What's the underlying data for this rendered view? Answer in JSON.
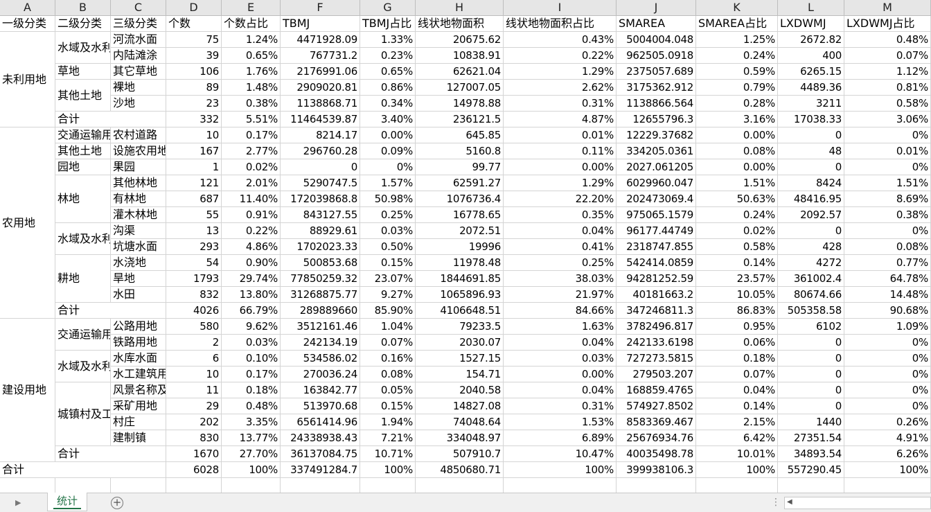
{
  "columns": [
    "A",
    "B",
    "C",
    "D",
    "E",
    "F",
    "G",
    "H",
    "I",
    "J",
    "K",
    "L",
    "M"
  ],
  "header_row": [
    "一级分类",
    "二级分类",
    "三级分类",
    "个数",
    "个数占比",
    "TBMJ",
    "TBMJ占比",
    "线状地物面积",
    "线状地物面积占比",
    "SMAREA",
    "SMAREA占比",
    "LXDWMJ",
    "LXDWMJ占比"
  ],
  "rows": [
    [
      "河流水面",
      "75",
      "1.24%",
      "4471928.09",
      "1.33%",
      "20675.62",
      "0.43%",
      "5004004.048",
      "1.25%",
      "2672.82",
      "0.48%"
    ],
    [
      "内陆滩涂",
      "39",
      "0.65%",
      "767731.2",
      "0.23%",
      "10838.91",
      "0.22%",
      "962505.0918",
      "0.24%",
      "400",
      "0.07%"
    ],
    [
      "其它草地",
      "106",
      "1.76%",
      "2176991.06",
      "0.65%",
      "62621.04",
      "1.29%",
      "2375057.689",
      "0.59%",
      "6265.15",
      "1.12%"
    ],
    [
      "裸地",
      "89",
      "1.48%",
      "2909020.81",
      "0.86%",
      "127007.05",
      "2.62%",
      "3175362.912",
      "0.79%",
      "4489.36",
      "0.81%"
    ],
    [
      "沙地",
      "23",
      "0.38%",
      "1138868.71",
      "0.34%",
      "14978.88",
      "0.31%",
      "1138866.564",
      "0.28%",
      "3211",
      "0.58%"
    ],
    [
      "",
      "332",
      "5.51%",
      "11464539.87",
      "3.40%",
      "236121.5",
      "4.87%",
      "12655796.3",
      "3.16%",
      "17038.33",
      "3.06%"
    ],
    [
      "农村道路",
      "10",
      "0.17%",
      "8214.17",
      "0.00%",
      "645.85",
      "0.01%",
      "12229.37682",
      "0.00%",
      "0",
      "0%"
    ],
    [
      "设施农用地",
      "167",
      "2.77%",
      "296760.28",
      "0.09%",
      "5160.8",
      "0.11%",
      "334205.0361",
      "0.08%",
      "48",
      "0.01%"
    ],
    [
      "果园",
      "1",
      "0.02%",
      "0",
      "0%",
      "99.77",
      "0.00%",
      "2027.061205",
      "0.00%",
      "0",
      "0%"
    ],
    [
      "其他林地",
      "121",
      "2.01%",
      "5290747.5",
      "1.57%",
      "62591.27",
      "1.29%",
      "6029960.047",
      "1.51%",
      "8424",
      "1.51%"
    ],
    [
      "有林地",
      "687",
      "11.40%",
      "172039868.8",
      "50.98%",
      "1076736.4",
      "22.20%",
      "202473069.4",
      "50.63%",
      "48416.95",
      "8.69%"
    ],
    [
      "灌木林地",
      "55",
      "0.91%",
      "843127.55",
      "0.25%",
      "16778.65",
      "0.35%",
      "975065.1579",
      "0.24%",
      "2092.57",
      "0.38%"
    ],
    [
      "沟渠",
      "13",
      "0.22%",
      "88929.61",
      "0.03%",
      "2072.51",
      "0.04%",
      "96177.44749",
      "0.02%",
      "0",
      "0%"
    ],
    [
      "坑塘水面",
      "293",
      "4.86%",
      "1702023.33",
      "0.50%",
      "19996",
      "0.41%",
      "2318747.855",
      "0.58%",
      "428",
      "0.08%"
    ],
    [
      "水浇地",
      "54",
      "0.90%",
      "500853.68",
      "0.15%",
      "11978.48",
      "0.25%",
      "542414.0859",
      "0.14%",
      "4272",
      "0.77%"
    ],
    [
      "旱地",
      "1793",
      "29.74%",
      "77850259.32",
      "23.07%",
      "1844691.85",
      "38.03%",
      "94281252.59",
      "23.57%",
      "361002.4",
      "64.78%"
    ],
    [
      "水田",
      "832",
      "13.80%",
      "31268875.77",
      "9.27%",
      "1065896.93",
      "21.97%",
      "40181663.2",
      "10.05%",
      "80674.66",
      "14.48%"
    ],
    [
      "",
      "4026",
      "66.79%",
      "289889660",
      "85.90%",
      "4106648.51",
      "84.66%",
      "347246811.3",
      "86.83%",
      "505358.58",
      "90.68%"
    ],
    [
      "公路用地",
      "580",
      "9.62%",
      "3512161.46",
      "1.04%",
      "79233.5",
      "1.63%",
      "3782496.817",
      "0.95%",
      "6102",
      "1.09%"
    ],
    [
      "铁路用地",
      "2",
      "0.03%",
      "242134.19",
      "0.07%",
      "2030.07",
      "0.04%",
      "242133.6198",
      "0.06%",
      "0",
      "0%"
    ],
    [
      "水库水面",
      "6",
      "0.10%",
      "534586.02",
      "0.16%",
      "1527.15",
      "0.03%",
      "727273.5815",
      "0.18%",
      "0",
      "0%"
    ],
    [
      "水工建筑用地",
      "10",
      "0.17%",
      "270036.24",
      "0.08%",
      "154.71",
      "0.00%",
      "279503.207",
      "0.07%",
      "0",
      "0%"
    ],
    [
      "风景名称及特殊用地",
      "11",
      "0.18%",
      "163842.77",
      "0.05%",
      "2040.58",
      "0.04%",
      "168859.4765",
      "0.04%",
      "0",
      "0%"
    ],
    [
      "采矿用地",
      "29",
      "0.48%",
      "513970.68",
      "0.15%",
      "14827.08",
      "0.31%",
      "574927.8502",
      "0.14%",
      "0",
      "0%"
    ],
    [
      "村庄",
      "202",
      "3.35%",
      "6561414.96",
      "1.94%",
      "74048.64",
      "1.53%",
      "8583369.467",
      "2.15%",
      "1440",
      "0.26%"
    ],
    [
      "建制镇",
      "830",
      "13.77%",
      "24338938.43",
      "7.21%",
      "334048.97",
      "6.89%",
      "25676934.76",
      "6.42%",
      "27351.54",
      "4.91%"
    ],
    [
      "",
      "1670",
      "27.70%",
      "36137084.75",
      "10.71%",
      "507910.7",
      "10.47%",
      "40035498.78",
      "10.01%",
      "34893.54",
      "6.26%"
    ],
    [
      "",
      "6028",
      "100%",
      "337491284.7",
      "100%",
      "4850680.71",
      "100%",
      "399938106.3",
      "100%",
      "557290.45",
      "100%"
    ]
  ],
  "a_groups": [
    {
      "label": "未利用地",
      "start": 0,
      "span": 6
    },
    {
      "label": "农用地",
      "start": 6,
      "span": 12
    },
    {
      "label": "建设用地",
      "start": 18,
      "span": 9
    },
    {
      "label": "合计",
      "start": 27,
      "span": 1
    }
  ],
  "b_groups": [
    {
      "label": "水域及水利设施用地",
      "start": 0,
      "span": 2
    },
    {
      "label": "草地",
      "start": 2,
      "span": 1
    },
    {
      "label": "其他土地",
      "start": 3,
      "span": 2
    },
    {
      "label": "合计",
      "start": 5,
      "span": 1
    },
    {
      "label": "交通运输用地",
      "start": 6,
      "span": 1
    },
    {
      "label": "其他土地",
      "start": 7,
      "span": 1
    },
    {
      "label": "园地",
      "start": 8,
      "span": 1
    },
    {
      "label": "林地",
      "start": 9,
      "span": 3
    },
    {
      "label": "水域及水利设施用地",
      "start": 12,
      "span": 2
    },
    {
      "label": "耕地",
      "start": 14,
      "span": 3
    },
    {
      "label": "合计",
      "start": 17,
      "span": 1
    },
    {
      "label": "交通运输用地",
      "start": 18,
      "span": 2
    },
    {
      "label": "水域及水利设施用地",
      "start": 20,
      "span": 2
    },
    {
      "label": "城镇村及工矿用地",
      "start": 22,
      "span": 4
    },
    {
      "label": "合计",
      "start": 26,
      "span": 1
    }
  ],
  "sheet_tab": "统计"
}
